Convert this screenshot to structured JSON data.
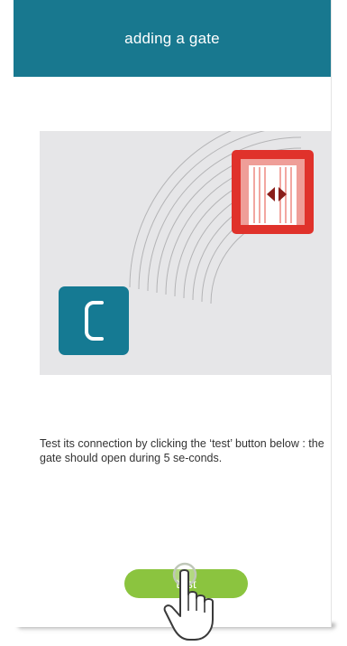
{
  "header": {
    "title": "adding a gate"
  },
  "illustration": {
    "controller_icon": "c-logo-icon",
    "gate_icon": "gate-icon",
    "signal_icon": "signal-waves-icon",
    "colors": {
      "controller": "#157a93",
      "gate_frame": "#e0322b",
      "background": "#e6e6e8"
    }
  },
  "instructions": {
    "text": "Test its connection by clicking the ‘test’ button below : the gate should open during 5 se-conds."
  },
  "actions": {
    "test_label": "test"
  },
  "cursor": {
    "icon": "hand-pointer-icon"
  },
  "colors": {
    "header": "#18788f",
    "button": "#8bc43f"
  }
}
